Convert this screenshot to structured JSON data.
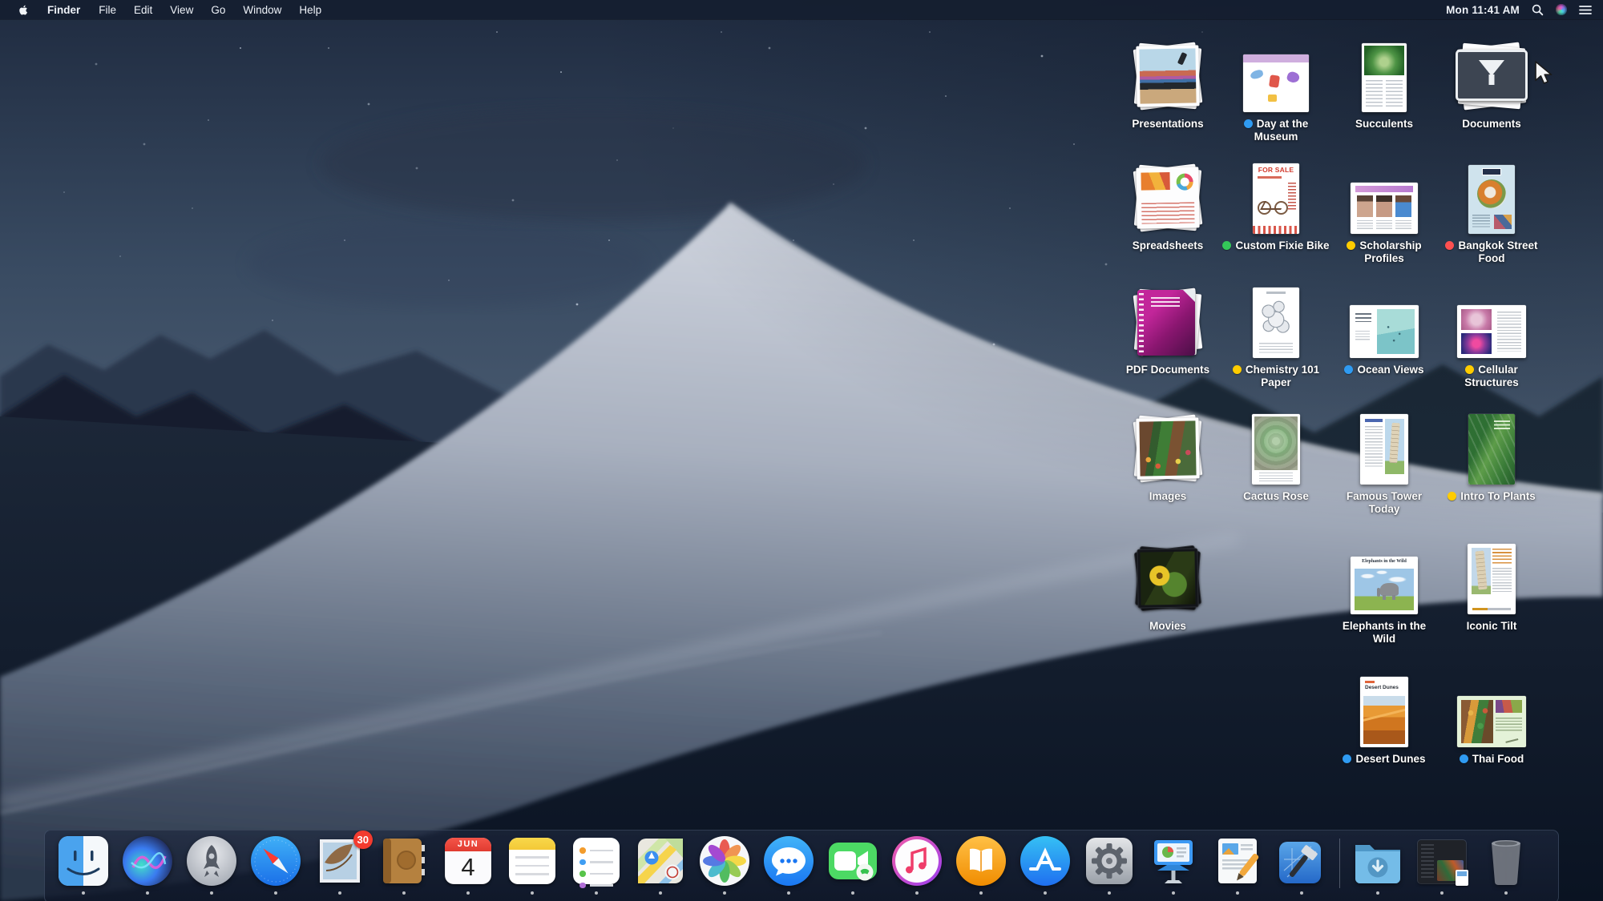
{
  "menu_bar": {
    "app_name": "Finder",
    "menus": [
      "Finder",
      "File",
      "Edit",
      "View",
      "Go",
      "Window",
      "Help"
    ],
    "clock": "Mon 11:41 AM",
    "status_icons": [
      "spotlight-icon",
      "siri-icon",
      "notification-center-icon"
    ]
  },
  "desktop": {
    "tag_colors": {
      "blue": "#2f9bf2",
      "green": "#34c759",
      "yellow": "#ffcc00",
      "red": "#ff5050"
    },
    "stacks": [
      {
        "label": "Presentations",
        "tag": null,
        "art": "photo-stack-presentations",
        "col": 0,
        "row": 0
      },
      {
        "label": "Day at the Museum",
        "tag": "blue",
        "art": "doc-museum",
        "col": 1,
        "row": 0
      },
      {
        "label": "Succulents",
        "tag": null,
        "art": "doc-succulents",
        "col": 2,
        "row": 0
      },
      {
        "label": "Documents",
        "tag": null,
        "art": "stack-documents-dark",
        "col": 3,
        "row": 0
      },
      {
        "label": "Spreadsheets",
        "tag": null,
        "art": "photo-stack-spreadsheets",
        "col": 0,
        "row": 1
      },
      {
        "label": "Custom Fixie Bike",
        "tag": "green",
        "art": "doc-forsale",
        "col": 1,
        "row": 1,
        "art_text": "FOR SALE"
      },
      {
        "label": "Scholarship Profiles",
        "tag": "yellow",
        "art": "doc-profiles",
        "col": 2,
        "row": 1
      },
      {
        "label": "Bangkok Street Food",
        "tag": "red",
        "art": "doc-bangkok",
        "col": 3,
        "row": 1
      },
      {
        "label": "PDF Documents",
        "tag": null,
        "art": "stack-pdf",
        "col": 0,
        "row": 2
      },
      {
        "label": "Chemistry 101 Paper",
        "tag": "yellow",
        "art": "doc-chemistry",
        "col": 1,
        "row": 2
      },
      {
        "label": "Ocean Views",
        "tag": "blue",
        "art": "doc-ocean",
        "col": 2,
        "row": 2
      },
      {
        "label": "Cellular Structures",
        "tag": "yellow",
        "art": "doc-cellular",
        "col": 3,
        "row": 2
      },
      {
        "label": "Images",
        "tag": null,
        "art": "photo-stack-images",
        "col": 0,
        "row": 3
      },
      {
        "label": "Cactus Rose",
        "tag": null,
        "art": "doc-cactus",
        "col": 1,
        "row": 3
      },
      {
        "label": "Famous Tower Today",
        "tag": null,
        "art": "doc-tower",
        "col": 2,
        "row": 3
      },
      {
        "label": "Intro To Plants",
        "tag": "yellow",
        "art": "doc-plants",
        "col": 3,
        "row": 3
      },
      {
        "label": "Movies",
        "tag": null,
        "art": "stack-movies",
        "col": 0,
        "row": 4
      },
      {
        "label": "Elephants in the Wild",
        "tag": null,
        "art": "doc-elephants",
        "col": 2,
        "row": 4,
        "art_text": "Elephants in the Wild"
      },
      {
        "label": "Iconic Tilt",
        "tag": null,
        "art": "doc-tilt",
        "col": 3,
        "row": 4
      },
      {
        "label": "Desert Dunes",
        "tag": "blue",
        "art": "doc-dunes",
        "col": 2,
        "row": 5,
        "art_text": "Desert Dunes"
      },
      {
        "label": "Thai Food",
        "tag": "blue",
        "art": "doc-thai",
        "col": 3,
        "row": 5
      }
    ]
  },
  "dock": {
    "calendar": {
      "month": "JUN",
      "day": "4"
    },
    "items": [
      {
        "name": "Finder"
      },
      {
        "name": "Siri"
      },
      {
        "name": "Launchpad"
      },
      {
        "name": "Safari"
      },
      {
        "name": "Mail",
        "badge": "30"
      },
      {
        "name": "Contacts"
      },
      {
        "name": "Calendar"
      },
      {
        "name": "Notes"
      },
      {
        "name": "Reminders"
      },
      {
        "name": "Maps"
      },
      {
        "name": "Photos"
      },
      {
        "name": "Messages"
      },
      {
        "name": "FaceTime"
      },
      {
        "name": "iTunes"
      },
      {
        "name": "Books"
      },
      {
        "name": "App Store"
      },
      {
        "name": "System Preferences"
      },
      {
        "name": "Keynote"
      },
      {
        "name": "Pages"
      },
      {
        "name": "Xcode"
      },
      {
        "name": "Downloads"
      },
      {
        "name": "Minimized Window"
      },
      {
        "name": "Trash"
      }
    ]
  },
  "wallpaper": {
    "name": "Mojave Night",
    "sky_top": "#1f2b40",
    "sky_mid": "#4d5e73",
    "dune_light": "#d0d5df",
    "dune_dark": "#0b1424"
  }
}
